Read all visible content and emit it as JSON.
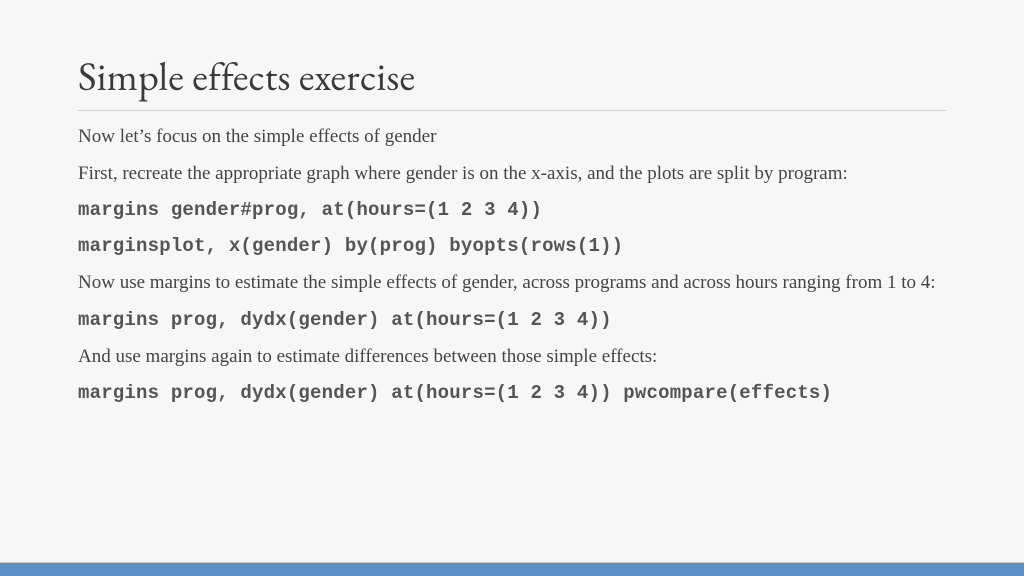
{
  "slide": {
    "title": "Simple effects exercise",
    "para1": "Now let’s focus on the simple effects of gender",
    "para2": "First, recreate the appropriate graph where gender is on the x-axis, and the plots are split by program:",
    "code1": "margins gender#prog, at(hours=(1 2 3 4))",
    "code2": "marginsplot, x(gender) by(prog) byopts(rows(1))",
    "para3": "Now use margins to estimate the simple effects of gender, across programs and across hours ranging from 1 to 4:",
    "code3": "margins prog, dydx(gender) at(hours=(1 2 3 4))",
    "para4": "And use margins again to estimate differences between those simple effects:",
    "code4": "margins prog, dydx(gender) at(hours=(1 2 3 4)) pwcompare(effects)"
  },
  "colors": {
    "accent": "#5c8fc5",
    "background": "#f7f7f5",
    "text": "#3a3a3a"
  }
}
